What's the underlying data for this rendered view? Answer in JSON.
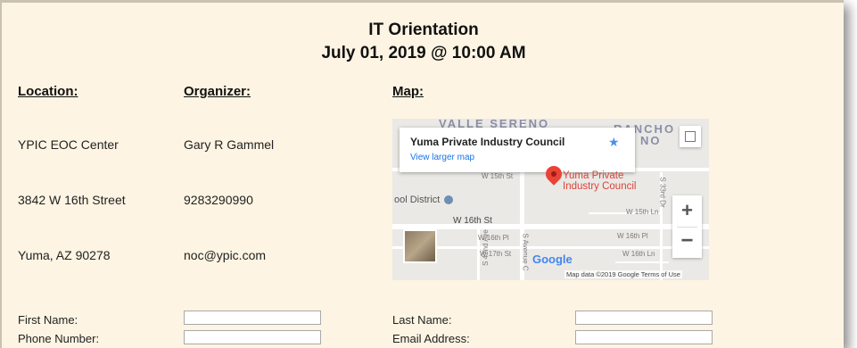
{
  "event": {
    "title": "IT Orientation",
    "datetime": "July 01, 2019 @ 10:00 AM"
  },
  "headers": {
    "location": "Location:",
    "organizer": "Organizer:",
    "map": "Map:"
  },
  "location": {
    "name": "YPIC EOC Center",
    "street": "3842 W 16th Street",
    "city": "Yuma, AZ 90278"
  },
  "organizer": {
    "name": "Gary R Gammel",
    "phone": "9283290990",
    "email": "noc@ypic.com"
  },
  "map": {
    "place_title": "Yuma Private Industry Council",
    "view_larger": "View larger map",
    "marker_label_line1": "Yuma Private",
    "marker_label_line2": "Industry Council",
    "area_label_1": "VALLE SERENO",
    "area_label_2": "RANCHO",
    "area_label_3": "NO",
    "school_district": "ool District",
    "streets": [
      "W 15th St",
      "W 16th St",
      "W 16th Pl",
      "W 17th St",
      "W 15th Ln",
      "W 16th Pl",
      "W 16th Ln",
      "S 42nd Ave",
      "S Avenue C",
      "S 33rd Dr"
    ],
    "zoom_in": "+",
    "zoom_out": "−",
    "google_logo": "Google",
    "attribution": "Map data ©2019 Google   Terms of Use"
  },
  "form": {
    "first_name_label": "First Name:",
    "last_name_label": "Last Name:",
    "phone_label": "Phone Number:",
    "email_label": "Email Address:",
    "first_name_value": "",
    "last_name_value": "",
    "phone_value": "",
    "email_value": ""
  }
}
